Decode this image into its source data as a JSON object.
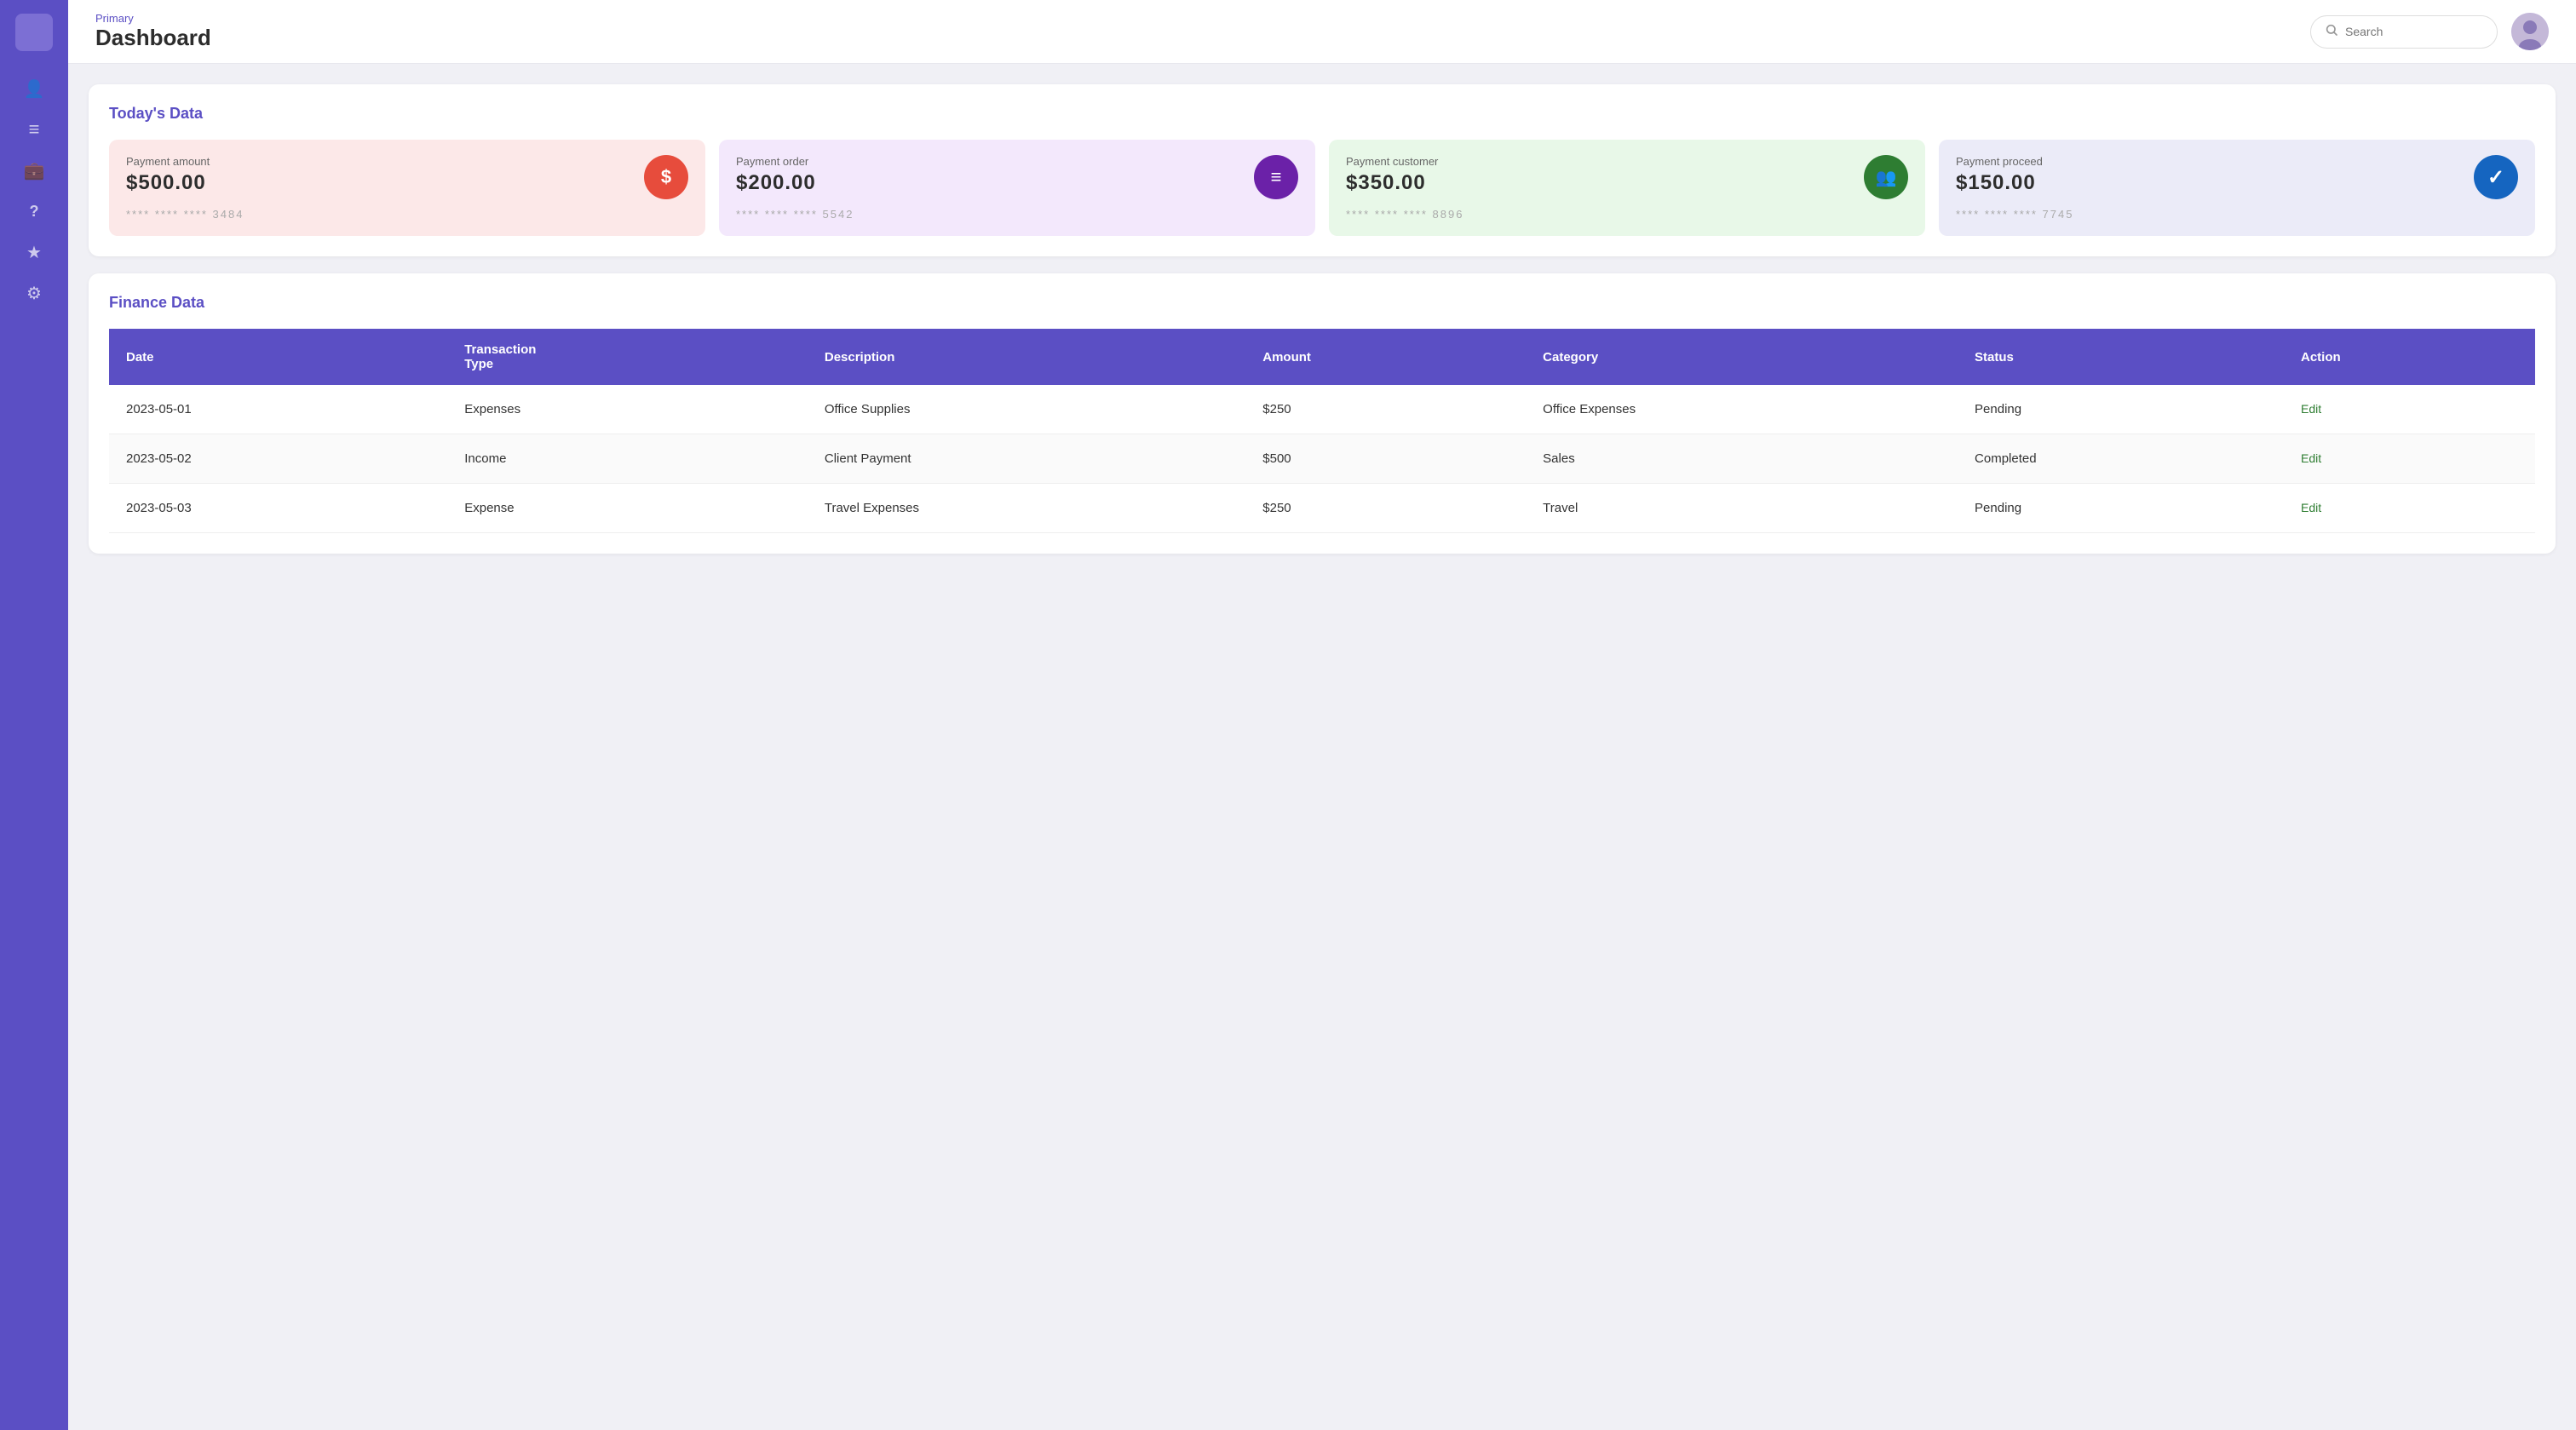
{
  "sidebar": {
    "logo_bg": "#7c6fd4",
    "icons": [
      {
        "name": "user-icon",
        "symbol": "👤",
        "active": false
      },
      {
        "name": "list-icon",
        "symbol": "≡",
        "active": false
      },
      {
        "name": "briefcase-icon",
        "symbol": "💼",
        "active": false
      },
      {
        "name": "help-icon",
        "symbol": "?",
        "active": false
      },
      {
        "name": "star-icon",
        "symbol": "★",
        "active": false
      },
      {
        "name": "settings-icon",
        "symbol": "⚙",
        "active": false
      }
    ]
  },
  "header": {
    "primary_label": "Primary",
    "title": "Dashboard",
    "search_placeholder": "Search"
  },
  "todays_data": {
    "section_title": "Today's Data",
    "cards": [
      {
        "label": "Payment amount",
        "amount": "$500.00",
        "icon": "$",
        "icon_style": "red",
        "card_style": "pink",
        "card_number": "**** **** **** 3484"
      },
      {
        "label": "Payment order",
        "amount": "$200.00",
        "icon": "≡",
        "icon_style": "dark-purple",
        "card_style": "purple",
        "card_number": "**** **** **** 5542"
      },
      {
        "label": "Payment customer",
        "amount": "$350.00",
        "icon": "👥",
        "icon_style": "dark-green",
        "card_style": "green",
        "card_number": "**** **** **** 8896"
      },
      {
        "label": "Payment proceed",
        "amount": "$150.00",
        "icon": "✓",
        "icon_style": "blue",
        "card_style": "lavender",
        "card_number": "**** **** **** 7745"
      }
    ]
  },
  "finance_data": {
    "section_title": "Finance Data",
    "columns": [
      "Date",
      "Transaction Type",
      "Description",
      "Amount",
      "Category",
      "Status",
      "Action"
    ],
    "rows": [
      {
        "date": "2023-05-01",
        "transaction_type": "Expenses",
        "description": "Office Supplies",
        "amount": "$250",
        "category": "Office Expenses",
        "status": "Pending",
        "action": "Edit"
      },
      {
        "date": "2023-05-02",
        "transaction_type": "Income",
        "description": "Client Payment",
        "amount": "$500",
        "category": "Sales",
        "status": "Completed",
        "action": "Edit"
      },
      {
        "date": "2023-05-03",
        "transaction_type": "Expense",
        "description": "Travel Expenses",
        "amount": "$250",
        "category": "Travel",
        "status": "Pending",
        "action": "Edit"
      }
    ]
  }
}
